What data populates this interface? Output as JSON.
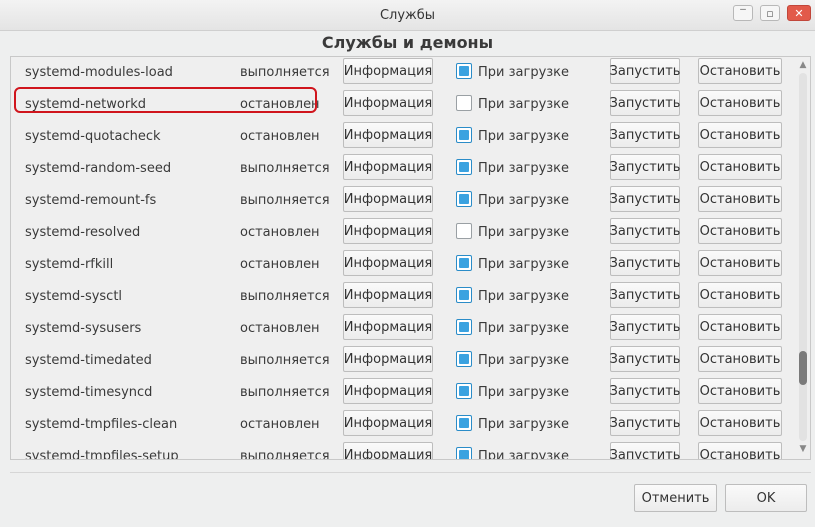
{
  "window": {
    "title": "Службы"
  },
  "header": {
    "title": "Службы и демоны"
  },
  "labels": {
    "info": "Информация",
    "on_boot": "При загрузке",
    "start": "Запустить",
    "stop": "Остановить"
  },
  "services": [
    {
      "name": "systemd-modules-load",
      "status": "выполняется",
      "on_boot": true
    },
    {
      "name": "systemd-networkd",
      "status": "остановлен",
      "on_boot": false,
      "highlighted": true
    },
    {
      "name": "systemd-quotacheck",
      "status": "остановлен",
      "on_boot": true
    },
    {
      "name": "systemd-random-seed",
      "status": "выполняется",
      "on_boot": true
    },
    {
      "name": "systemd-remount-fs",
      "status": "выполняется",
      "on_boot": true
    },
    {
      "name": "systemd-resolved",
      "status": "остановлен",
      "on_boot": false
    },
    {
      "name": "systemd-rfkill",
      "status": "остановлен",
      "on_boot": true
    },
    {
      "name": "systemd-sysctl",
      "status": "выполняется",
      "on_boot": true
    },
    {
      "name": "systemd-sysusers",
      "status": "остановлен",
      "on_boot": true
    },
    {
      "name": "systemd-timedated",
      "status": "выполняется",
      "on_boot": true
    },
    {
      "name": "systemd-timesyncd",
      "status": "выполняется",
      "on_boot": true
    },
    {
      "name": "systemd-tmpfiles-clean",
      "status": "остановлен",
      "on_boot": true
    },
    {
      "name": "systemd-tmpfiles-setup",
      "status": "выполняется",
      "on_boot": true
    }
  ],
  "scrollbar": {
    "position_fraction": 0.8
  },
  "dialog": {
    "cancel_label": "Отменить",
    "ok_label": "OK"
  },
  "colors": {
    "accent": "#3aa2e0",
    "highlight": "#d0151d"
  },
  "icons": {
    "minimize": "minimize-icon",
    "maximize": "maximize-icon",
    "close": "close-icon"
  }
}
